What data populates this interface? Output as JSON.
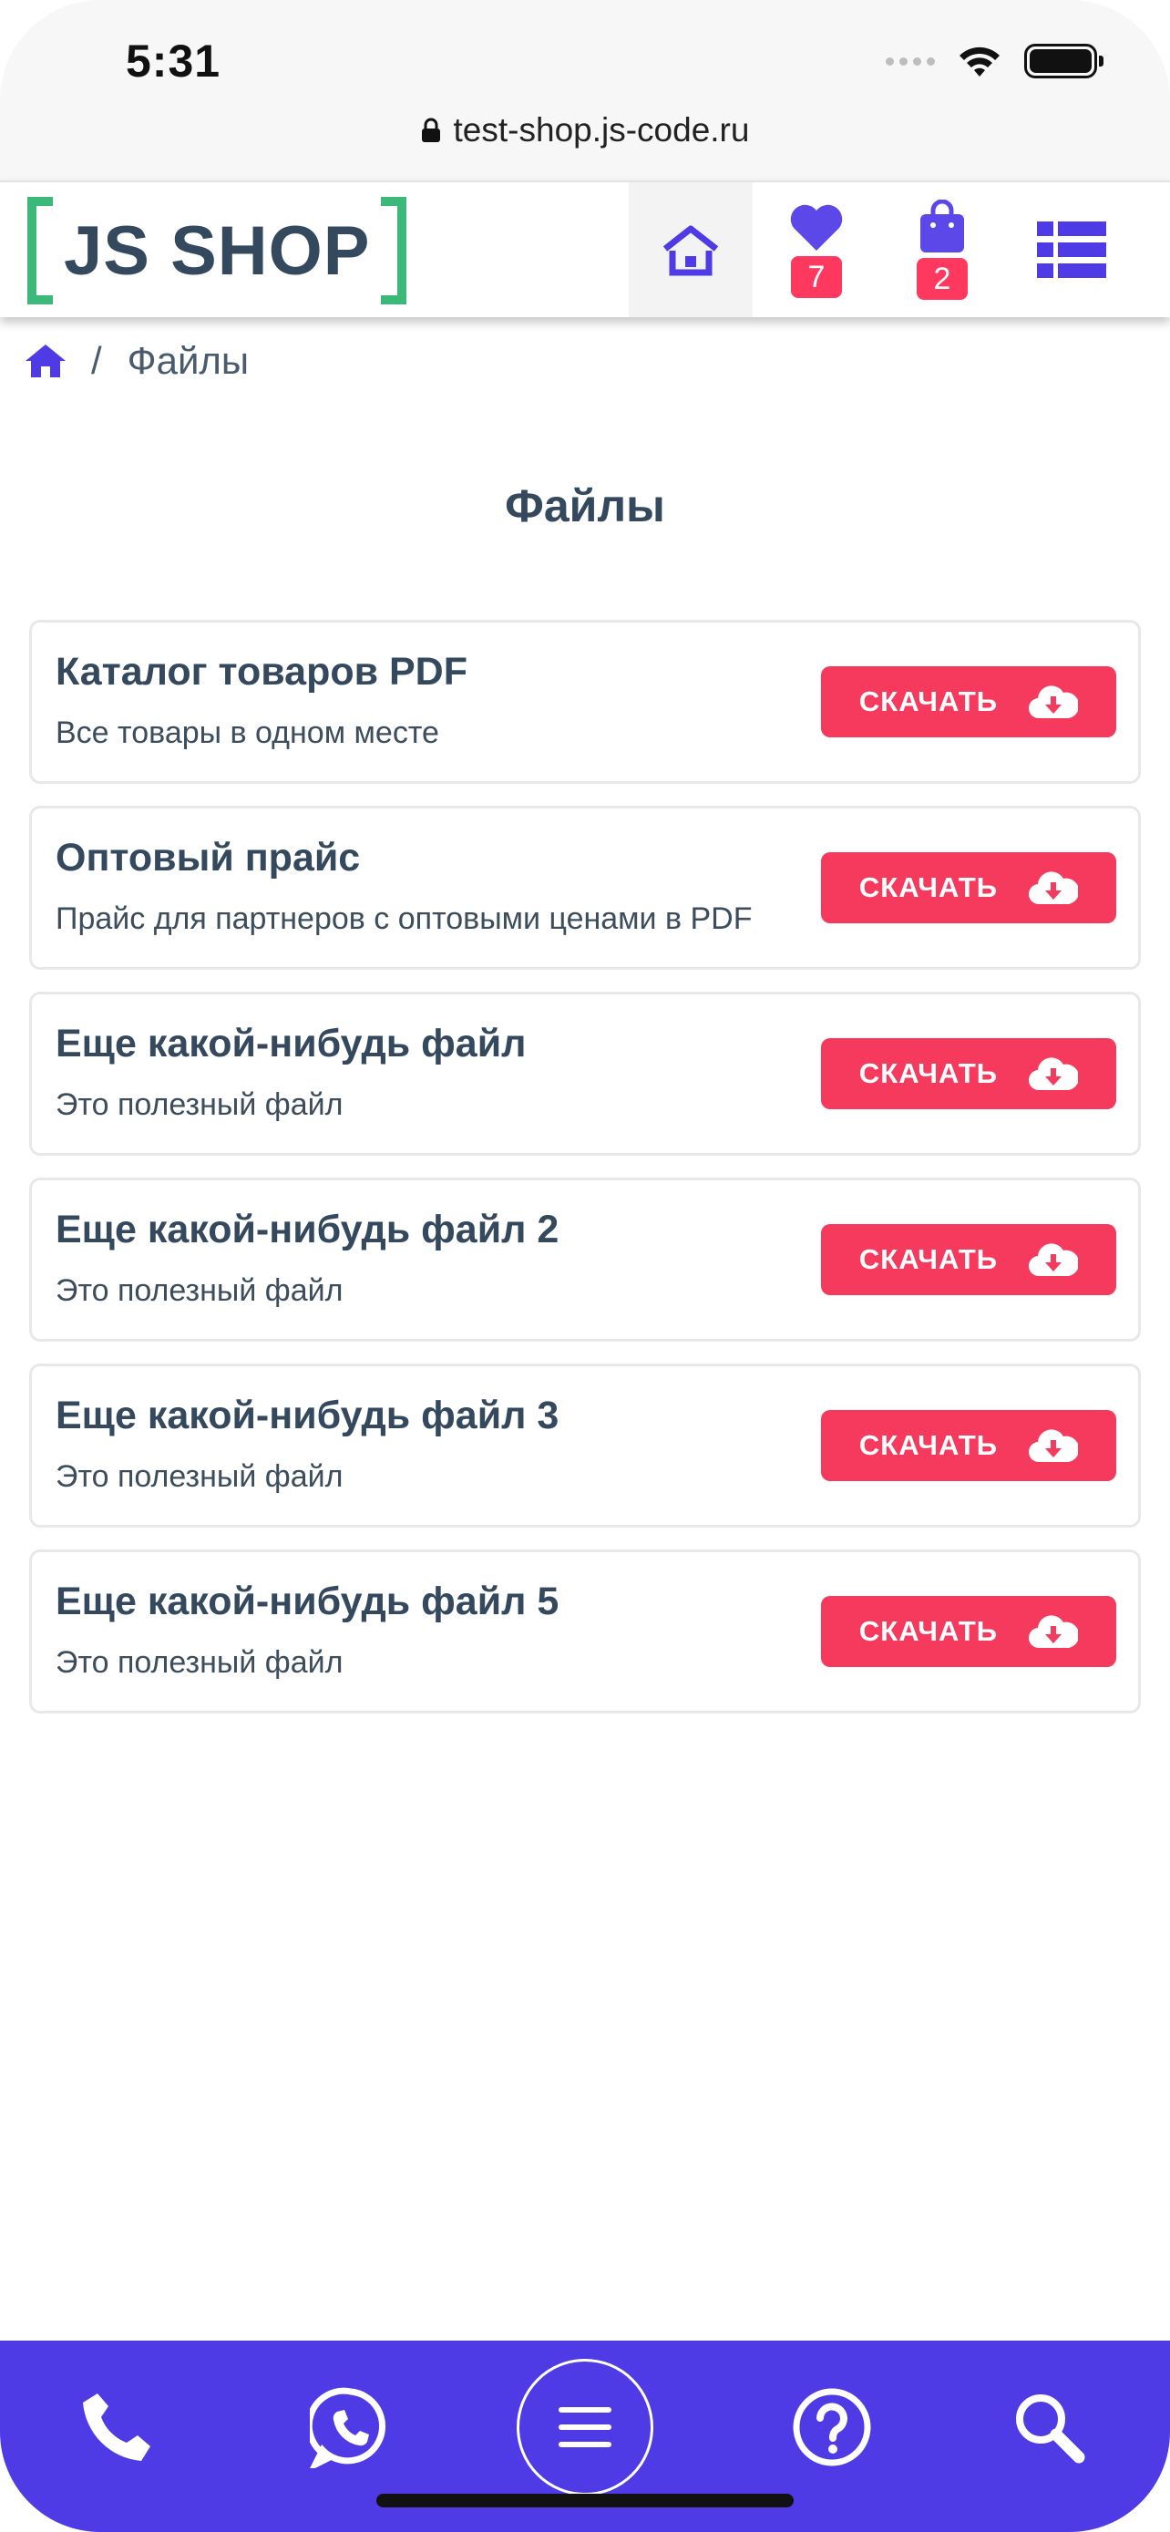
{
  "status_bar": {
    "time": "5:31",
    "url": "test-shop.js-code.ru"
  },
  "header": {
    "logo_text": "JS SHOP",
    "nav": [
      {
        "name": "home",
        "icon": "home-icon",
        "active": true
      },
      {
        "name": "favorites",
        "icon": "heart-icon",
        "badge": "7"
      },
      {
        "name": "cart",
        "icon": "shopping-bag-icon",
        "badge": "2"
      },
      {
        "name": "menu",
        "icon": "list-icon"
      }
    ]
  },
  "breadcrumb": {
    "separator": "/",
    "current": "Файлы"
  },
  "page_title": "Файлы",
  "files": [
    {
      "title": "Каталог товаров PDF",
      "description": "Все товары в одном месте",
      "button": "СКАЧАТЬ"
    },
    {
      "title": "Оптовый прайс",
      "description": "Прайс для партнеров с оптовыми ценами в PDF",
      "button": "СКАЧАТЬ"
    },
    {
      "title": "Еще какой-нибудь файл",
      "description": "Это полезный файл",
      "button": "СКАЧАТЬ"
    },
    {
      "title": "Еще какой-нибудь файл 2",
      "description": "Это полезный файл",
      "button": "СКАЧАТЬ"
    },
    {
      "title": "Еще какой-нибудь файл 3",
      "description": "Это полезный файл",
      "button": "СКАЧАТЬ"
    },
    {
      "title": "Еще какой-нибудь файл 5",
      "description": "Это полезный файл",
      "button": "СКАЧАТЬ"
    }
  ],
  "bottom_bar": [
    "phone-icon",
    "whatsapp-icon",
    "menu-icon",
    "help-icon",
    "search-icon"
  ],
  "colors": {
    "accent": "#4f3be6",
    "logo_green": "#3cb878",
    "download_button": "#f63a5e",
    "badge": "#ff3860",
    "text": "#34495e"
  }
}
